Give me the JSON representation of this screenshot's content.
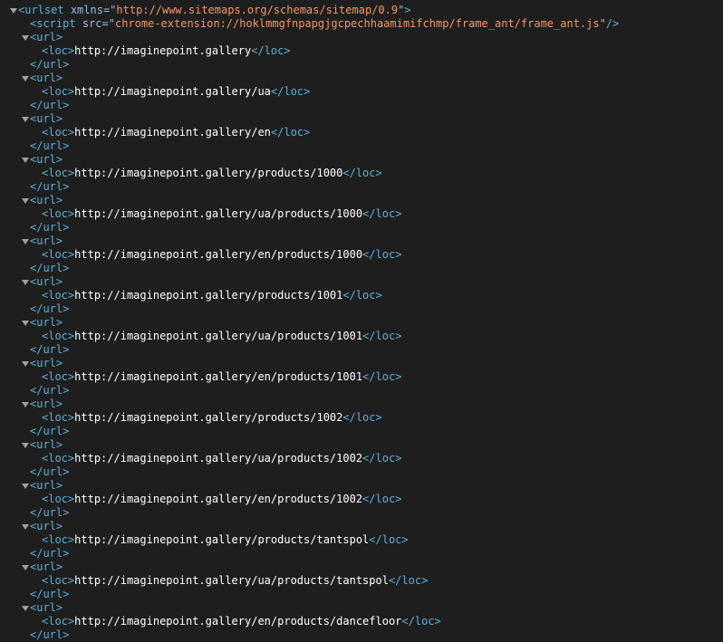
{
  "theme": {
    "background": "#1e1e1e",
    "tag_color": "#5db0d7",
    "attr_color": "#9bbbdc",
    "value_color": "#f29766",
    "text_color": "#ffffff",
    "toggle_color": "#a0a0a0"
  },
  "icons": {
    "toggle": "triangle-down-icon"
  },
  "root": {
    "tag": "urlset",
    "attr_name": "xmlns",
    "attr_value": "http://www.sitemaps.org/schemas/sitemap/0.9"
  },
  "script": {
    "tag": "script",
    "attr_name": "src",
    "attr_value": "chrome-extension://hoklmmgfnpapgjgcpechhaamimifchmp/frame_ant/frame_ant.js"
  },
  "url_tag": "url",
  "loc_tag": "loc",
  "urls": [
    "http://imaginepoint.gallery",
    "http://imaginepoint.gallery/ua",
    "http://imaginepoint.gallery/en",
    "http://imaginepoint.gallery/products/1000",
    "http://imaginepoint.gallery/ua/products/1000",
    "http://imaginepoint.gallery/en/products/1000",
    "http://imaginepoint.gallery/products/1001",
    "http://imaginepoint.gallery/ua/products/1001",
    "http://imaginepoint.gallery/en/products/1001",
    "http://imaginepoint.gallery/products/1002",
    "http://imaginepoint.gallery/ua/products/1002",
    "http://imaginepoint.gallery/en/products/1002",
    "http://imaginepoint.gallery/products/tantspol",
    "http://imaginepoint.gallery/ua/products/tantspol",
    "http://imaginepoint.gallery/en/products/dancefloor"
  ]
}
